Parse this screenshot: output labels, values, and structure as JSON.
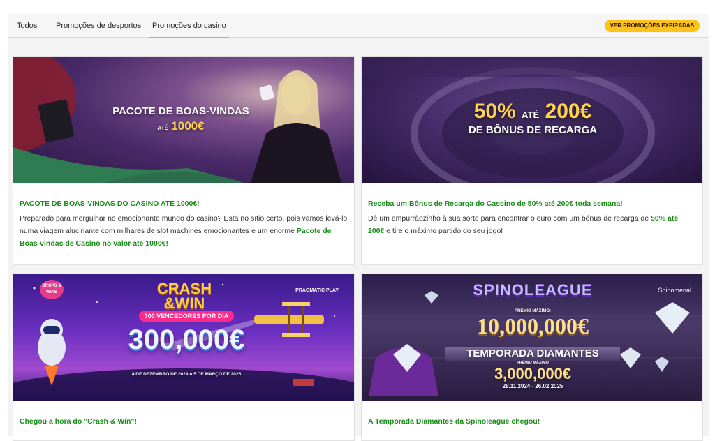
{
  "tabs": [
    {
      "label": "Todos"
    },
    {
      "label": "Promoções de desportos"
    },
    {
      "label": "Promoções do casino"
    }
  ],
  "expired_button": "VER PROMOÇÕES EXPIRADAS",
  "colors": {
    "accent": "#f2a900",
    "green": "#1a8b1a",
    "button": "#ffc21a"
  },
  "cards": [
    {
      "banner": {
        "line1": "PACOTE DE BOAS-VINDAS",
        "line2_prefix": "ATÉ",
        "line2_value": "1000€"
      },
      "title": "PACOTE DE BOAS-VINDAS DO CASINO ATÉ 1000€!",
      "text_before": "Preparado para mergulhar no emocionante mundo do casino? Está no sítio certo, pois vamos levá-lo numa viagem alucinante com milhares de slot machines emocionantes e um enorme ",
      "text_highlight": "Pacote de Boas-vindas de Casino no valor até 1000€!",
      "text_after": ""
    },
    {
      "banner": {
        "pct": "50%",
        "ate": "ATÉ",
        "amount": "200€",
        "line2": "DE BÔNUS DE RECARGA"
      },
      "title": "Receba um Bônus de Recarga do Cassino de 50% até 200€ toda semana!",
      "text_before": "Dê um empurrãozinho à sua sorte para encontrar o ouro com um bónus de recarga de ",
      "text_highlight": "50% até 200€",
      "text_after": " e tire o máximo partido do seu jogo!"
    },
    {
      "banner": {
        "badge": "DROPS & WINS",
        "brand": "PRAGMATIC PLAY",
        "title1": "CRASH",
        "title2": "&WIN",
        "winners": "300 VENCEDORES POR DIA",
        "prize": "300,000€",
        "dates": "4 DE DEZEMBRO DE 2024 A 5 DE MARÇO DE 2025"
      },
      "title": "Chegou a hora do \"Crash & Win\"!"
    },
    {
      "banner": {
        "logo": "SPINOLEAGUE",
        "brand": "Spinomenal",
        "max_label": "PRÉMIO MÁXIMO:",
        "max_prize": "10,000,000€",
        "season": "TEMPORADA DIAMANTES",
        "sub_label": "PRÉMIO MÁXIMO",
        "sub_prize": "3,000,000€",
        "dates": "28.11.2024 - 26.02.2025"
      },
      "title": "A Temporada Diamantes da Spinoleague chegou!"
    }
  ]
}
